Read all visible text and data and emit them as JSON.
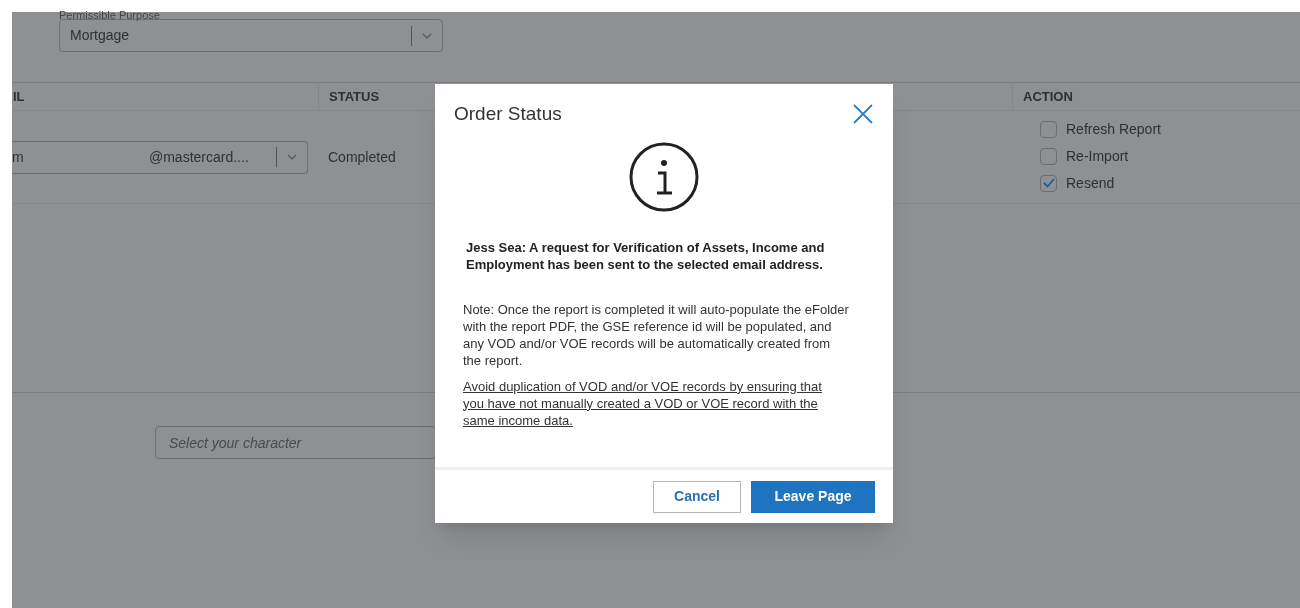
{
  "purpose_field": {
    "label": "Permissible Purpose",
    "value": "Mortgage"
  },
  "table": {
    "columns": [
      "IL",
      "STATUS",
      "ACTION"
    ],
    "rows": [
      {
        "email_start": "m",
        "email_end": "@mastercard....",
        "status": "Completed",
        "actions": [
          {
            "label": "Refresh Report",
            "checked": false
          },
          {
            "label": "Re-Import",
            "checked": false
          },
          {
            "label": "Resend",
            "checked": true
          }
        ]
      }
    ]
  },
  "character_field": {
    "placeholder": "Select your character"
  },
  "dialog": {
    "title": "Order Status",
    "message": "Jess Sea: A request for Verification of Assets, Income and Employment has been sent to the selected email address.",
    "note": "Note: Once the report is completed it will auto-populate the eFolder with the report PDF, the GSE reference id will be populated, and any VOD and/or VOE records will be automatically created from the report.",
    "link": "Avoid duplication of VOD and/or VOE records by ensuring that you have not manually created a VOD or VOE record with the same income data.",
    "buttons": [
      {
        "label": "Cancel",
        "kind": "secondary"
      },
      {
        "label": "Leave Page",
        "kind": "primary"
      }
    ]
  }
}
